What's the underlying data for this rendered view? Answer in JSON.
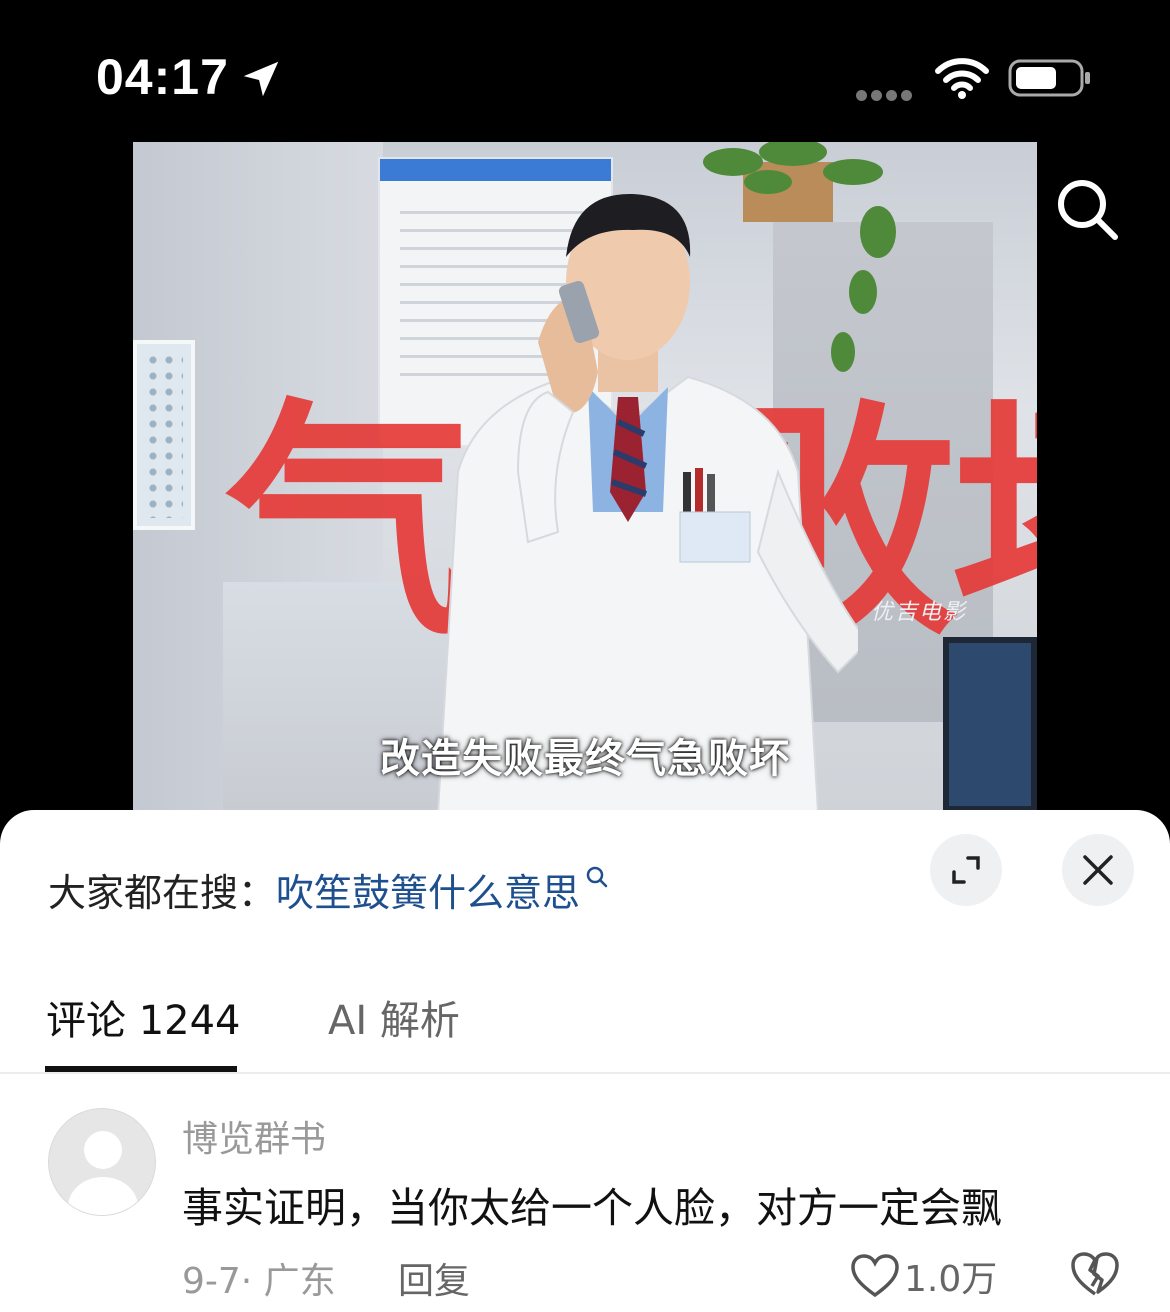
{
  "status_bar": {
    "time": "04:17"
  },
  "video": {
    "overlay_text": "气急败坏",
    "watermark": "优吉电影",
    "subtitle": "改造失败最终气急败坏"
  },
  "hot_search": {
    "prefix": "大家都在搜：",
    "query": "吹笙鼓簧什么意思"
  },
  "tabs": [
    {
      "label": "评论 1244",
      "active": true
    },
    {
      "label": "AI 解析",
      "active": false
    }
  ],
  "comment": {
    "username": "博览群书",
    "text": "事实证明，当你太给一个人脸，对方一定会飘",
    "meta": "9-7· 广东",
    "reply_label": "回复",
    "like_count": "1.0万"
  },
  "colors": {
    "link": "#1e4f8f",
    "overlay_red": "#e53b38"
  }
}
